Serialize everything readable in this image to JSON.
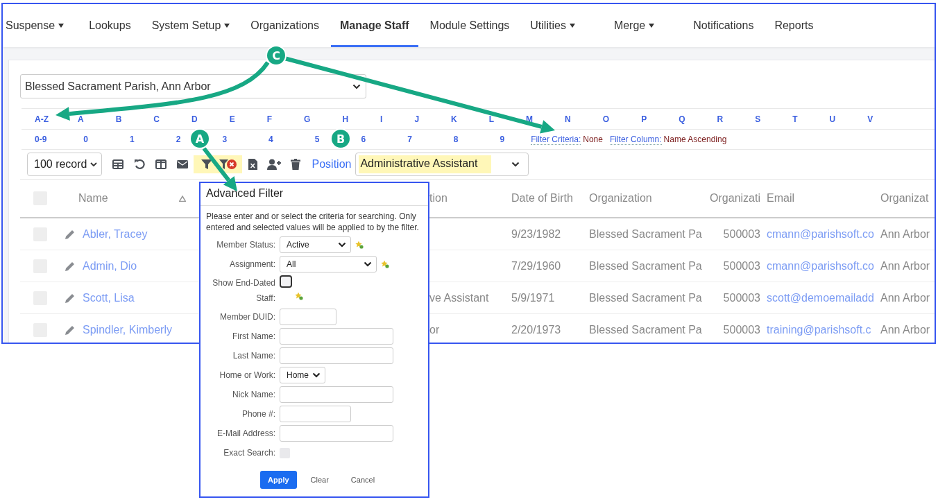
{
  "nav": {
    "items": [
      {
        "label": "Suspense",
        "dropdown": true,
        "selected": false
      },
      {
        "label": "Lookups",
        "dropdown": false,
        "selected": false
      },
      {
        "label": "System Setup",
        "dropdown": true,
        "selected": false
      },
      {
        "label": "Organizations",
        "dropdown": false,
        "selected": false
      },
      {
        "label": "Manage Staff",
        "dropdown": false,
        "selected": true
      },
      {
        "label": "Module Settings",
        "dropdown": false,
        "selected": false
      },
      {
        "label": "Utilities",
        "dropdown": true,
        "selected": false
      },
      {
        "label": "Merge",
        "dropdown": true,
        "selected": false
      },
      {
        "label": "Notifications",
        "dropdown": false,
        "selected": false
      },
      {
        "label": "Reports",
        "dropdown": false,
        "selected": false
      }
    ]
  },
  "organization_select": {
    "value": "Blessed Sacrament Parish, Ann Arbor"
  },
  "letter_filter": [
    "A-Z",
    "A",
    "B",
    "C",
    "D",
    "E",
    "F",
    "G",
    "H",
    "I",
    "J",
    "K",
    "L",
    "M",
    "N",
    "O",
    "P",
    "Q",
    "R",
    "S",
    "T",
    "U",
    "V"
  ],
  "digit_filter": [
    "0-9",
    "0",
    "1",
    "2",
    "3",
    "4",
    "5",
    "6",
    "7",
    "8",
    "9"
  ],
  "filter_status": [
    {
      "label": "Filter Criteria:",
      "value": "None"
    },
    {
      "label": "Filter Column:",
      "value": "Name Ascending"
    }
  ],
  "toolbar": {
    "page_size": "100 record",
    "tools": [
      {
        "kind": "grid",
        "highlighted": false
      },
      {
        "kind": "undo",
        "highlighted": false
      },
      {
        "kind": "columns",
        "highlighted": false
      },
      {
        "kind": "mail",
        "highlighted": false
      },
      {
        "kind": "filter",
        "highlighted": true
      },
      {
        "kind": "clear-filter",
        "highlighted": true
      },
      {
        "kind": "excel",
        "highlighted": false
      },
      {
        "kind": "add-user",
        "highlighted": false
      },
      {
        "kind": "trash",
        "highlighted": false
      }
    ],
    "position_label": "Position",
    "position_value": "Administrative Assistant"
  },
  "table": {
    "columns": [
      {
        "kind": "check",
        "checked": false
      },
      {
        "kind": "name",
        "label": "Name",
        "sort_ascending": true
      },
      {
        "kind": "text",
        "label": "tion"
      },
      {
        "kind": "text",
        "label": "Date of Birth"
      },
      {
        "kind": "text",
        "label": "Organization"
      },
      {
        "kind": "number",
        "label": "Organizati"
      },
      {
        "kind": "link",
        "label": "Email"
      },
      {
        "kind": "text",
        "label": "Organizat"
      }
    ],
    "rows": [
      {
        "checked": false,
        "cells": [
          null,
          "Abler, Tracey",
          null,
          "9/23/1982",
          "Blessed Sacrament Pa",
          "500003",
          "cmann@parishsoft.co",
          "Ann Arbor"
        ]
      },
      {
        "checked": false,
        "cells": [
          null,
          "Admin, Dio",
          null,
          "7/29/1960",
          "Blessed Sacrament Pa",
          "500003",
          "cmann@parishsoft.co",
          "Ann Arbor"
        ]
      },
      {
        "checked": false,
        "cells": [
          null,
          "Scott, Lisa",
          "ve Assistant",
          "5/9/1971",
          "Blessed Sacrament Pa",
          "500003",
          "scott@demoemailadd",
          "Ann Arbor"
        ]
      },
      {
        "checked": false,
        "cells": [
          null,
          "Spindler, Kimberly",
          "or",
          "2/20/1973",
          "Blessed Sacrament Pa",
          "500003",
          "training@parishsoft.c",
          "Ann Arbor"
        ]
      }
    ]
  },
  "advanced_filter": {
    "title": "Advanced Filter",
    "description": "Please enter and or select the criteria for searching. Only entered and selected values will be applied to by the filter.",
    "fields": [
      {
        "kind": "select",
        "label": "Member Status:",
        "value": "Active",
        "star": true
      },
      {
        "kind": "select",
        "label": "Assignment:",
        "value": "All",
        "star": true
      },
      {
        "kind": "checkbox",
        "label": "Show End-Dated Staff:",
        "checked": false,
        "disabled": false,
        "star": true
      },
      {
        "kind": "text",
        "label": "Member DUID:"
      },
      {
        "kind": "text",
        "label": "First Name:"
      },
      {
        "kind": "text",
        "label": "Last Name:"
      },
      {
        "kind": "select",
        "label": "Home or Work:",
        "value": "Home",
        "star": false
      },
      {
        "kind": "text",
        "label": "Nick Name:"
      },
      {
        "kind": "text",
        "label": "Phone #:"
      },
      {
        "kind": "text",
        "label": "E-Mail Address:"
      },
      {
        "kind": "checkbox",
        "label": "Exact Search:",
        "checked": false,
        "disabled": true,
        "star": false
      }
    ],
    "buttons": [
      {
        "label": "Apply",
        "primary": true
      },
      {
        "label": "Clear",
        "primary": false
      },
      {
        "label": "Cancel",
        "primary": false
      }
    ]
  },
  "annotations": [
    {
      "label": "C"
    },
    {
      "label": "A"
    },
    {
      "label": "B"
    }
  ]
}
